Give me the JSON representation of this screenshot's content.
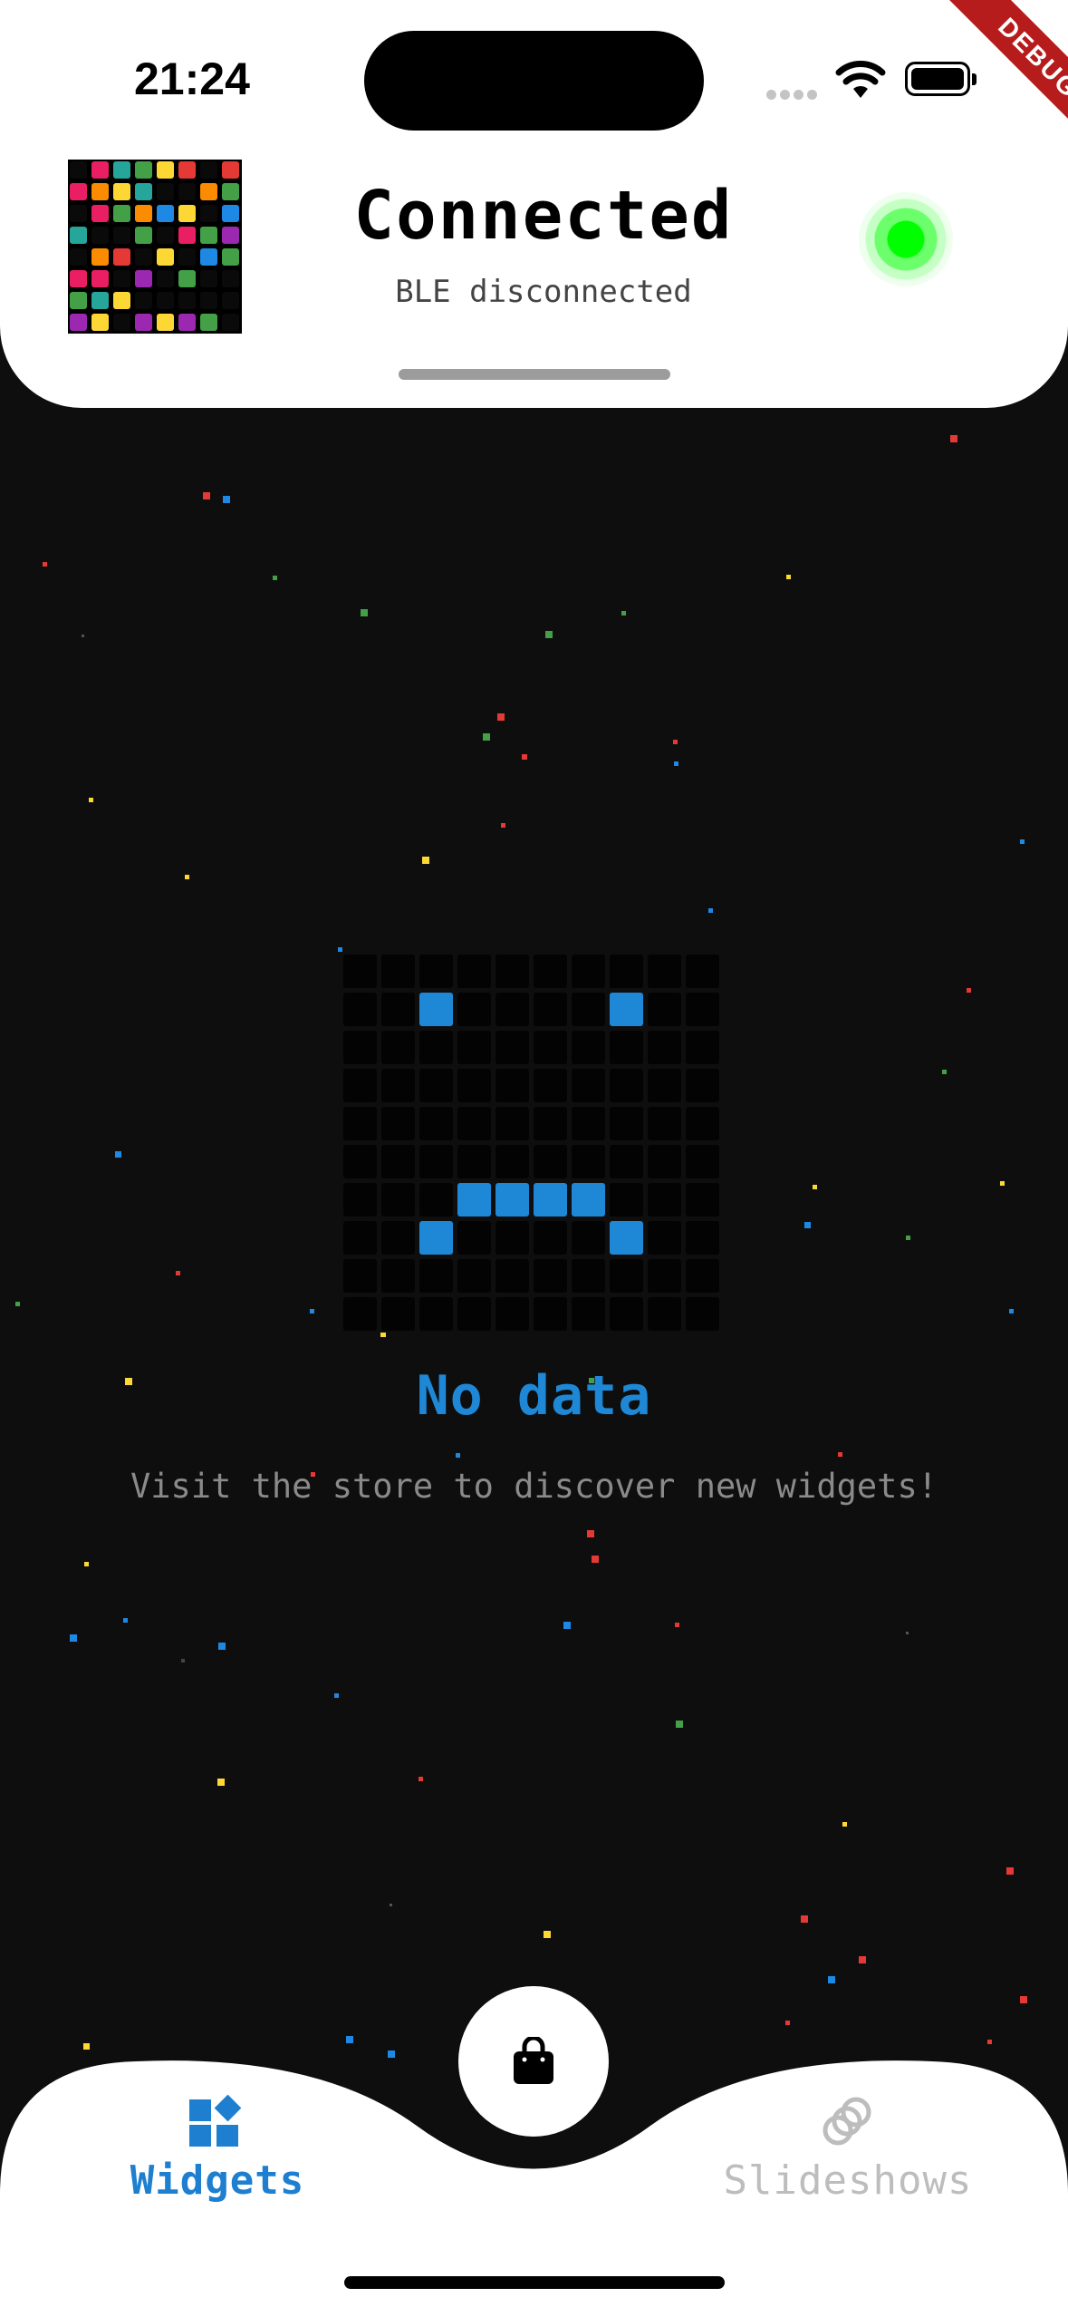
{
  "status_bar": {
    "time": "21:24"
  },
  "debug_banner": "DEBUG",
  "header": {
    "title": "Connected",
    "subtitle": "BLE disconnected",
    "status_color": "#00ff00"
  },
  "empty_state": {
    "title": "No data",
    "message": "Visit the store to discover new widgets!",
    "accent_color": "#1e88d6",
    "face_pixels": [
      [
        2,
        1
      ],
      [
        7,
        1
      ],
      [
        3,
        6
      ],
      [
        4,
        6
      ],
      [
        5,
        6
      ],
      [
        6,
        6
      ],
      [
        2,
        7
      ],
      [
        7,
        7
      ]
    ]
  },
  "bottom_nav": {
    "store_icon": "shopping-bag-icon",
    "tabs": [
      {
        "label": "Widgets",
        "icon": "widgets-icon",
        "active": true
      },
      {
        "label": "Slideshows",
        "icon": "slideshows-icon",
        "active": false
      }
    ]
  },
  "colors": {
    "background": "#0e0e0e",
    "active_tab": "#1e7fd0",
    "inactive_tab": "#bdbdbd"
  }
}
